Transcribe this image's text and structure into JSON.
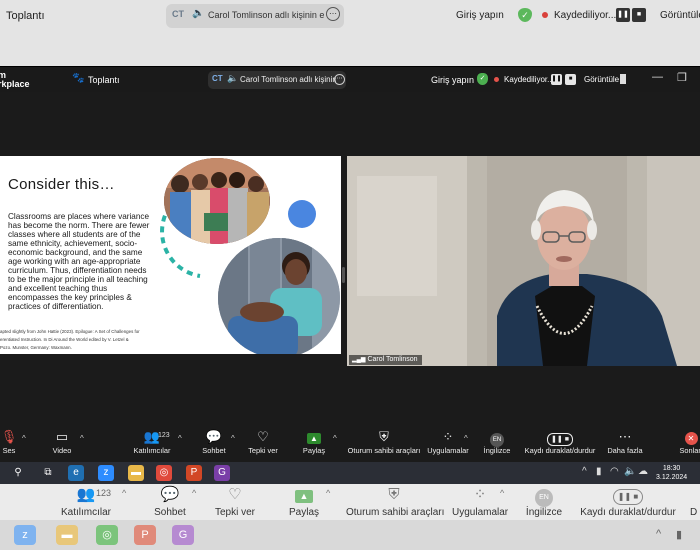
{
  "outer_window": {
    "title": "Toplantı",
    "share_pill": {
      "initials": "CT",
      "text": "Carol Tomlinson adlı kişinin e",
      "more": "⋯"
    },
    "sign_in": "Giriş yapın",
    "recording": "Kaydediliyor...",
    "view": "Görüntüle"
  },
  "zoom_window": {
    "app_name_line1": "m",
    "app_name_line2": "rkplace",
    "meeting_label": "Toplantı",
    "share_pill": {
      "initials": "CT",
      "text": "Carol Tomlinson adlı kişinin e",
      "more": "⋯"
    },
    "sign_in": "Giriş yapın",
    "recording": "Kaydediliyor...",
    "view": "Görüntüle"
  },
  "slide": {
    "title": "Consider this…",
    "body": "Classrooms are places where variance has become the norm. There are fewer classes where all students are of the same ethnicity, achievement, socio-economic background, and the same age working with an age-appropriate curriculum.  Thus, differentiation needs to be the major principle in all teaching and excellent teaching thus encompasses the key principles & practices of differentiation.",
    "citation_line1": "apted slightly from John Hattie (2023). Epilogue: A Set of Challenges for",
    "citation_line2": "erentiated Instruction. In Di Around the World edited by V. Letzel &",
    "citation_line3": "Pozo.  Munster, Germany: Waxmann."
  },
  "speaker": {
    "name": "Carol Tomlinson"
  },
  "toolbar": {
    "mute_label": "Ses",
    "video_label": "Video",
    "participants_label": "Katılımcılar",
    "participants_count": "123",
    "chat_label": "Sohbet",
    "react_label": "Tepki ver",
    "share_label": "Paylaş",
    "host_tools_label": "Oturum sahibi araçları",
    "apps_label": "Uygulamalar",
    "english_label": "İngilizce",
    "english_badge": "EN",
    "pause_label": "Kaydı duraklat/durdur",
    "more_label": "Daha fazla",
    "end_label": "Sonlan"
  },
  "taskbar": {
    "time": "18:30",
    "date": "3.12.2024"
  },
  "outer_toolbar": {
    "participants_label": "Katılımcılar",
    "participants_count": "123",
    "chat_label": "Sohbet",
    "react_label": "Tepki ver",
    "share_label": "Paylaş",
    "host_tools_label": "Oturum sahibi araçları",
    "apps_label": "Uygulamalar",
    "english_label": "İngilizce",
    "english_badge": "EN",
    "pause_label": "Kaydı duraklat/durdur",
    "cut_label": "D"
  },
  "colors": {
    "zoom_bg": "#1b1b1b",
    "share_green": "#2d8a2d",
    "end_red": "#e5534b",
    "slide_accent_blue": "#4a86e0",
    "slide_accent_teal": "#2bb3a6"
  }
}
